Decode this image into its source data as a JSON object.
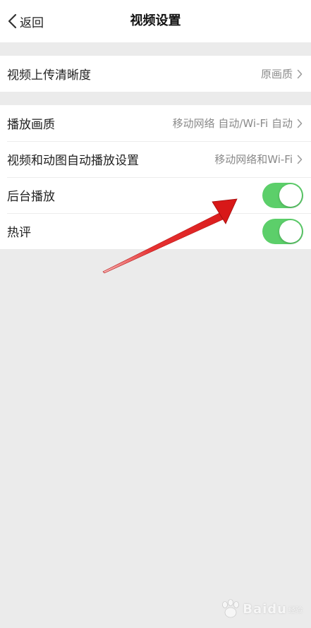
{
  "nav": {
    "back_label": "返回",
    "title": "视频设置"
  },
  "upload_group": {
    "items": [
      {
        "label": "视频上传清晰度",
        "value": "原画质"
      }
    ]
  },
  "playback_group": {
    "items": [
      {
        "label": "播放画质",
        "value": "移动网络 自动/Wi-Fi 自动"
      },
      {
        "label": "视频和动图自动播放设置",
        "value": "移动网络和Wi-Fi"
      },
      {
        "label": "后台播放",
        "toggle": true
      },
      {
        "label": "热评",
        "toggle": true
      }
    ]
  },
  "colors": {
    "toggle_on": "#5ccf6a",
    "background": "#ebebeb",
    "annotation_arrow": "#e02020"
  },
  "watermark": {
    "text": "Baidu",
    "sub": "经验"
  }
}
